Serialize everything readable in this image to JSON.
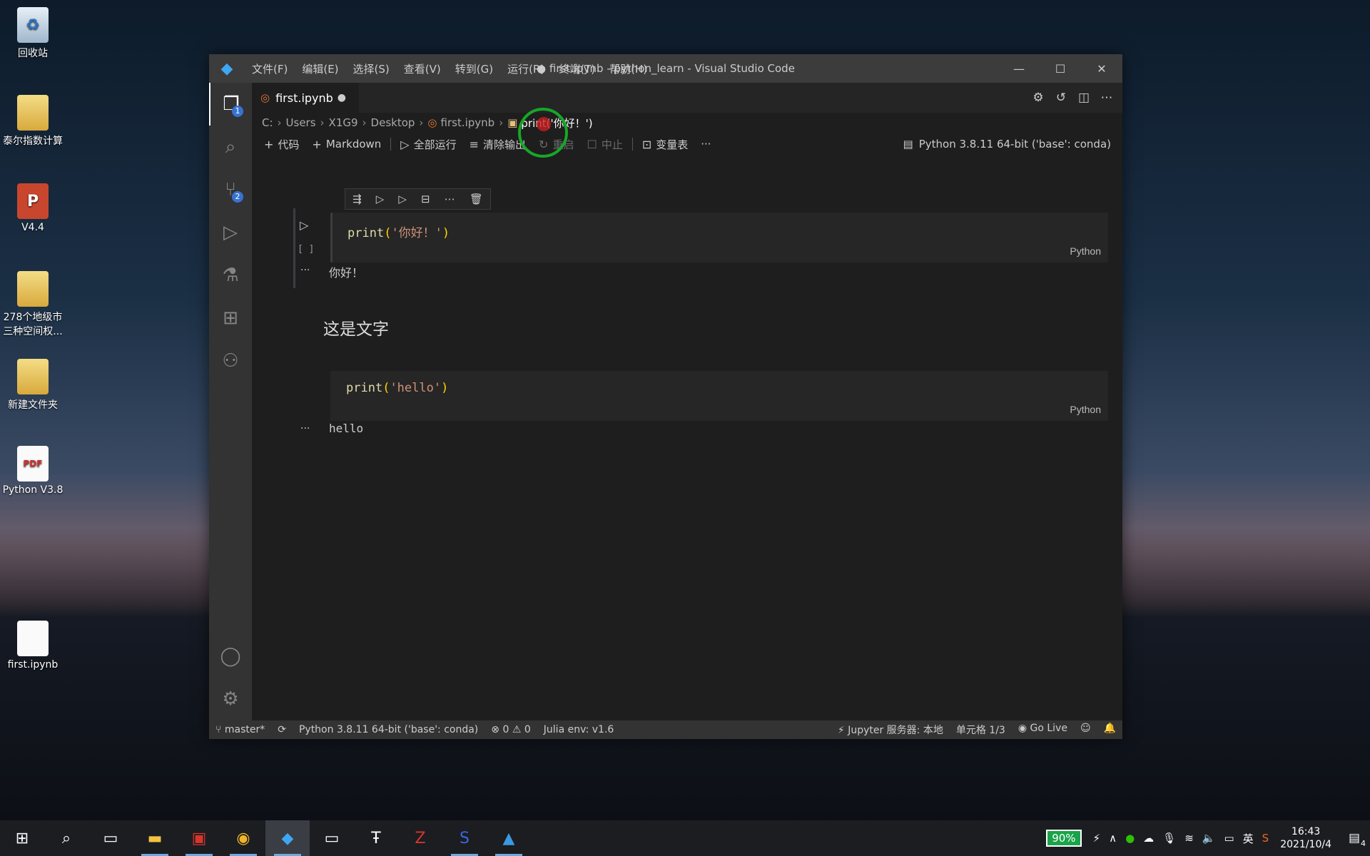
{
  "desktop": {
    "icons": [
      {
        "label": "回收站",
        "glyph": "♻",
        "kind": "recycle"
      },
      {
        "label": "泰尔指数计算",
        "glyph": "",
        "kind": "folder"
      },
      {
        "label": "V4.4",
        "glyph": "P",
        "kind": "ppt"
      },
      {
        "label": "278个地级市三种空间权...",
        "glyph": "",
        "kind": "folder"
      },
      {
        "label": "新建文件夹",
        "glyph": "",
        "kind": "folder"
      },
      {
        "label": "Python V3.8",
        "glyph": "PDF",
        "kind": "pdf"
      },
      {
        "label": "first.ipynb",
        "glyph": "",
        "kind": "file"
      }
    ]
  },
  "window": {
    "title": "● first.ipynb - python_learn - Visual Studio Code",
    "menu": [
      "文件(F)",
      "编辑(E)",
      "选择(S)",
      "查看(V)",
      "转到(G)",
      "运行(R)",
      "终端(T)",
      "帮助(H)"
    ]
  },
  "activity": {
    "explorer_badge": "1",
    "scm_badge": "2"
  },
  "tab": {
    "label": "first.ipynb",
    "dirty": "●"
  },
  "breadcrumb": [
    "C:",
    "Users",
    "X1G9",
    "Desktop",
    "first.ipynb",
    "print('你好！')"
  ],
  "toolbar": {
    "code": "代码",
    "markdown": "Markdown",
    "run_all": "全部运行",
    "clear_output": "清除输出",
    "restart": "重启",
    "interrupt": "中止",
    "variables": "变量表",
    "more": "···",
    "kernel": "Python 3.8.11 64-bit ('base': conda)"
  },
  "cells": {
    "cell1": {
      "fn": "print",
      "open": "(",
      "str": "'你好！'",
      "close": ")",
      "lang": "Python",
      "exec_count": "[ ]",
      "output": "你好！"
    },
    "markdown": "这是文字",
    "cell2": {
      "fn": "print",
      "open": "(",
      "str": "'hello'",
      "close": ")",
      "lang": "Python",
      "output": "hello"
    },
    "out_dots": "···"
  },
  "statusbar": {
    "branch": "master*",
    "interpreter": "Python 3.8.11 64-bit ('base': conda)",
    "errors": "0",
    "warnings": "0",
    "julia": "Julia env: v1.6",
    "jupyter": "Jupyter 服务器: 本地",
    "cell_pos": "单元格 1/3",
    "go_live": "Go Live"
  },
  "taskbar": {
    "battery": "90%",
    "ime": "英",
    "time": "16:43",
    "date": "2021/10/4",
    "notif_count": "4"
  }
}
